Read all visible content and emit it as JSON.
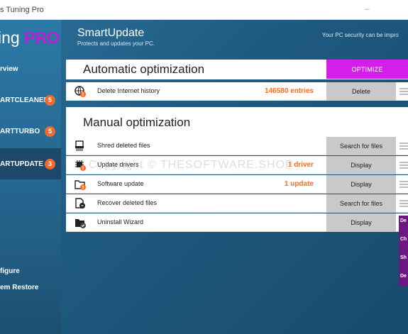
{
  "window": {
    "title": "s Tuning Pro",
    "minimize": "–"
  },
  "logo": {
    "text": "ing ",
    "pro": "PRO"
  },
  "sidebar": {
    "items": [
      {
        "label": "rview",
        "badge": ""
      },
      {
        "label": "ARTCLEANER",
        "badge": "5"
      },
      {
        "label": "ARTTURBO",
        "badge": "5"
      },
      {
        "label": "ARTUPDATE",
        "badge": "3"
      }
    ],
    "bottom": [
      "figure",
      "em Restore"
    ]
  },
  "header": {
    "title": "SmartUpdate",
    "subtitle": "Protects and updates your PC.",
    "right": "Your PC security can be impro"
  },
  "automatic": {
    "title": "Automatic optimization",
    "optimize_label": "OPTIMIZE",
    "rows": [
      {
        "name": "Delete Internet history",
        "count": "146580 entries",
        "action": "Delete",
        "icon": "globe-icon"
      }
    ]
  },
  "manual": {
    "title": "Manual optimization",
    "rows": [
      {
        "name": "Shred deleted files",
        "count": "",
        "action": "Search for files",
        "icon": "shredder-icon"
      },
      {
        "name": "Update drivers",
        "count": "1 driver",
        "action": "Display",
        "icon": "chip-icon"
      },
      {
        "name": "Software update",
        "count": "1 update",
        "action": "Display",
        "icon": "folder-icon"
      },
      {
        "name": "Recover deleted files",
        "count": "",
        "action": "Search for files",
        "icon": "recover-icon"
      },
      {
        "name": "Uninstall Wizard",
        "count": "",
        "action": "Display",
        "icon": "uninstall-icon"
      }
    ]
  },
  "purple_panel": [
    "De",
    "Ch",
    "Sh",
    "De"
  ],
  "watermark": "Copyright © THESOFTWARE.SHOP",
  "colors": {
    "accent": "#d31fe7",
    "badge": "#f06a2f",
    "count": "#ff6a22",
    "sidebar_active": "#1e4869"
  }
}
